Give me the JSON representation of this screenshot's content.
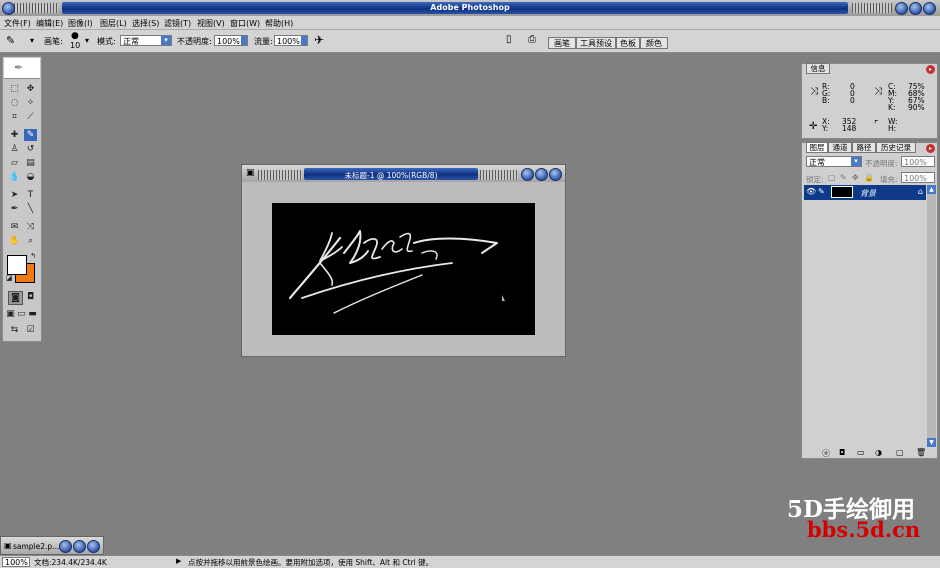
{
  "app": {
    "title": "Adobe Photoshop"
  },
  "menu": {
    "items": [
      "文件(F)",
      "编辑(E)",
      "图像(I)",
      "图层(L)",
      "选择(S)",
      "滤镜(T)",
      "视图(V)",
      "窗口(W)",
      "帮助(H)"
    ]
  },
  "options": {
    "brush_label": "画笔:",
    "brush_size": "10",
    "mode_label": "模式:",
    "mode_value": "正常",
    "opacity_label": "不透明度:",
    "opacity_value": "100%",
    "flow_label": "流量:",
    "flow_value": "100%",
    "palette_tabs": [
      "画笔",
      "工具预设",
      "色板",
      "颜色"
    ]
  },
  "colors": {
    "foreground": "#ffffff",
    "background": "#f07a10",
    "accent": "#0f2f80"
  },
  "document": {
    "title": "未标题-1 @ 100%(RGB/8)"
  },
  "info": {
    "tab": "信息",
    "r_label": "R:",
    "r": "0",
    "g_label": "G:",
    "g": "0",
    "b_label": "B:",
    "b": "0",
    "c_label": "C:",
    "c": "75%",
    "m_label": "M:",
    "m": "68%",
    "y_label": "Y:",
    "y": "67%",
    "k_label": "K:",
    "k": "90%",
    "x_label": "X:",
    "x": "352",
    "yy_label": "Y:",
    "yy": "148",
    "w_label": "W:",
    "h_label": "H:"
  },
  "layers": {
    "tabs": [
      "图层",
      "通道",
      "路径",
      "历史记录"
    ],
    "blend": "正常",
    "opacity_label": "不透明度:",
    "opacity": "100%",
    "lock_label": "锁定:",
    "fill_label": "填充:",
    "fill": "100%",
    "items": [
      {
        "name": "背景"
      }
    ]
  },
  "taskbar": {
    "doc": "sample2.p..."
  },
  "status": {
    "zoom": "100%",
    "doc_info": "文档:234.4K/234.4K",
    "hint": "点按并拖移以用前景色绘画。要用附加选项，使用 Shift、Alt 和 Ctrl 键。"
  },
  "watermark": {
    "line1": "5D手绘御用",
    "line2": "bbs.5d.cn"
  }
}
